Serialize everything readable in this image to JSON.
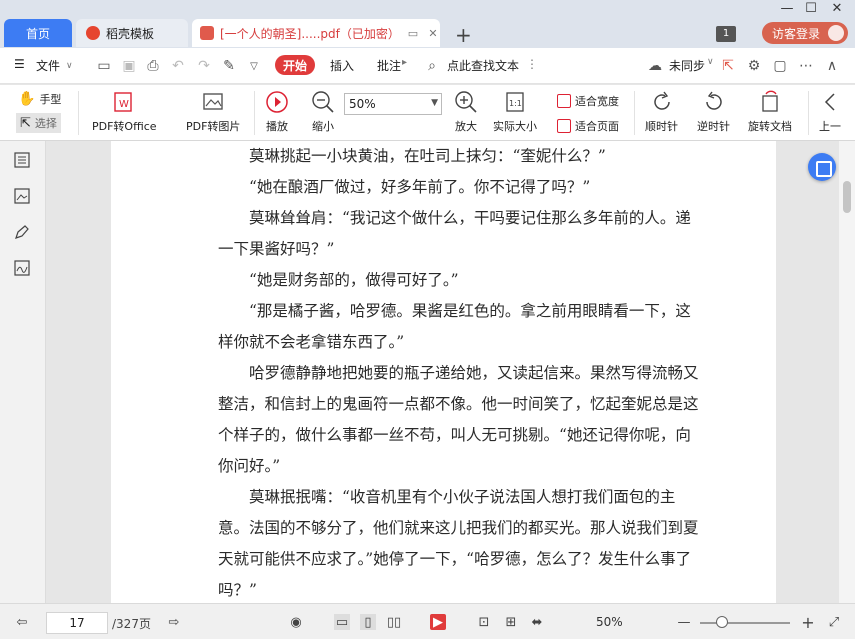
{
  "tabs": {
    "home": "首页",
    "wps": "稻壳模板",
    "doc": "[一个人的朝圣].....pdf（已加密）"
  },
  "titlebar": {
    "page_badge": "1",
    "login": "访客登录"
  },
  "menubar": {
    "file": "文件",
    "start": "开始",
    "insert": "插入",
    "annotate": "批注",
    "search": "点此查找文本",
    "sync": "未同步"
  },
  "ribbon": {
    "hand": "手型",
    "select": "选择",
    "pdf_to_office": "PDF转Office",
    "pdf_to_image": "PDF转图片",
    "play": "播放",
    "zoom_out": "缩小",
    "zoom_value": "50%",
    "zoom_in": "放大",
    "actual_size": "实际大小",
    "fit_width": "适合宽度",
    "fit_page": "适合页面",
    "clockwise": "顺时针",
    "counter_clockwise": "逆时针",
    "rotate_doc": "旋转文档",
    "prev": "上一"
  },
  "document": {
    "paragraphs": [
      "　　莫琳挑起一小块黄油，在吐司上抹匀：“奎妮什么？”",
      "　　“她在酿酒厂做过，好多年前了。你不记得了吗？”",
      "　　莫琳耸耸肩：“我记这个做什么，干吗要记住那么多年前的人。递一下果酱好吗？”",
      "　　“她是财务部的，做得可好了。”",
      "　　“那是橘子酱，哈罗德。果酱是红色的。拿之前用眼睛看一下，这样你就不会老拿错东西了。”",
      "　　哈罗德静静地把她要的瓶子递给她，又读起信来。果然写得流畅又整洁，和信封上的鬼画符一点都不像。他一时间笑了，忆起奎妮总是这个样子的，做什么事都一丝不苟，叫人无可挑剔。“她还记得你呢，向你问好。”",
      "　　莫琳抿抿嘴：“收音机里有个小伙子说法国人想打我们面包的主意。法国的不够分了，他们就来这儿把我们的都买光。那人说我们到夏天就可能供不应求了。”她停了一下，“哈罗德，怎么了？发生什么事了吗？”"
    ]
  },
  "statusbar": {
    "page": "17",
    "total": "/327页",
    "zoom": "50%"
  }
}
